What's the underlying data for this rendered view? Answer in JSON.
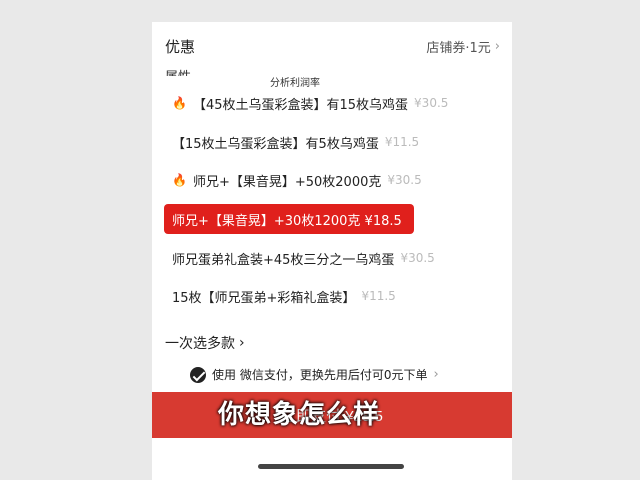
{
  "header": {
    "title": "优惠",
    "coupon_label": "店铺券·1元",
    "chevron": "chevron-right-icon"
  },
  "attribute_label": "属性",
  "watermark": "分析利润率",
  "options": [
    {
      "hot": true,
      "label": "【45枚土乌蛋彩盒装】有15枚乌鸡蛋",
      "price": "¥30.5"
    },
    {
      "hot": false,
      "label": "【15枚土乌蛋彩盒装】有5枚乌鸡蛋",
      "price": "¥11.5"
    },
    {
      "hot": true,
      "label": "师兄+【果音晃】+50枚2000克",
      "price": "¥30.5"
    },
    {
      "hot": false,
      "label": "师兄+【果音晃】+30枚1200克 ¥18.5",
      "price": "",
      "selected": true
    },
    {
      "hot": false,
      "label": "师兄蛋弟礼盒装+45枚三分之一乌鸡蛋",
      "price": "¥30.5"
    },
    {
      "hot": false,
      "label": "15枚【师兄蛋弟+彩箱礼盒装】",
      "price": "¥11.5"
    }
  ],
  "multi_select": "一次选多款",
  "payment": {
    "text": "使用 微信支付，更换先用后付可0元下单",
    "icon": "wechat-icon"
  },
  "pay_button": "立即支付 ¥18.5",
  "subtitle": "你想象怎么样",
  "colors": {
    "accent": "#e0201c",
    "button": "#d73a31",
    "background": "#e9e9e9"
  }
}
